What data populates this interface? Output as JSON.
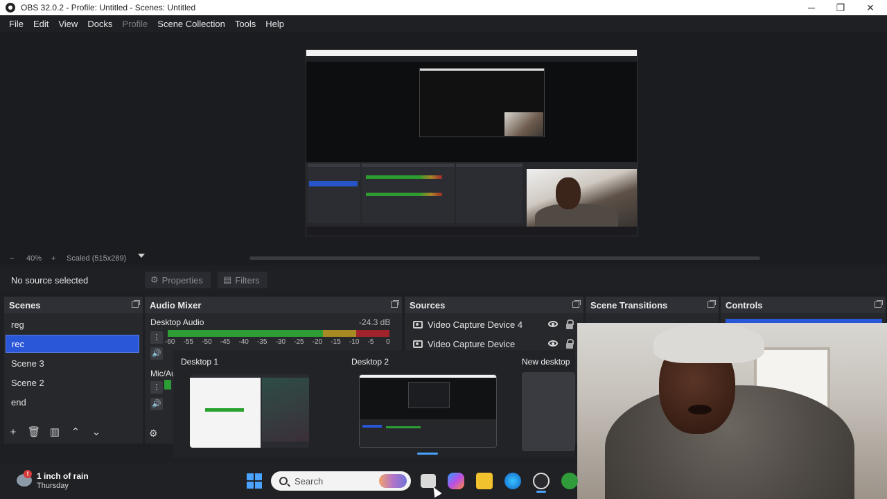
{
  "window": {
    "title": "OBS 32.0.2 - Profile: Untitled - Scenes: Untitled",
    "min_icon": "minimize-icon",
    "max_icon": "restore-icon",
    "close_icon": "close-icon"
  },
  "menu": {
    "items": [
      "File",
      "Edit",
      "View",
      "Docks",
      "Profile",
      "Scene Collection",
      "Tools",
      "Help"
    ]
  },
  "preview_toolbar": {
    "zoom_out": "−",
    "zoom": "40%",
    "zoom_in": "+",
    "scale_mode": "Scaled (515x289)",
    "dropdown_icon": "caret-down-icon"
  },
  "context": {
    "status": "No source selected",
    "properties_label": "Properties",
    "filters_label": "Filters"
  },
  "scenes": {
    "title": "Scenes",
    "items": [
      {
        "label": "reg",
        "active": false
      },
      {
        "label": "rec",
        "active": true
      },
      {
        "label": "Scene 3",
        "active": false
      },
      {
        "label": "Scene 2",
        "active": false
      },
      {
        "label": "end",
        "active": false
      }
    ]
  },
  "mixer": {
    "title": "Audio Mixer",
    "channels": [
      {
        "name": "Desktop Audio",
        "db": "-24.3 dB"
      },
      {
        "name": "Mic/Au",
        "db": ""
      }
    ],
    "ticks": [
      "-60",
      "-55",
      "-50",
      "-45",
      "-40",
      "-35",
      "-30",
      "-25",
      "-20",
      "-15",
      "-10",
      "-5",
      "0"
    ]
  },
  "sources": {
    "title": "Sources",
    "items": [
      "Video Capture Device 4",
      "Video Capture Device"
    ]
  },
  "transitions": {
    "title": "Scene Transitions"
  },
  "controls": {
    "title": "Controls"
  },
  "taskview": {
    "desktops": [
      "Desktop 1",
      "Desktop 2",
      "New desktop"
    ]
  },
  "taskbar": {
    "weather_line1": "1 inch of rain",
    "weather_line2": "Thursday",
    "weather_badge": "!",
    "search_placeholder": "Search"
  },
  "colors": {
    "accent": "#2a56d8",
    "meter_green": "#2c9e35",
    "meter_yellow": "#a78a23",
    "meter_red": "#a1242c"
  }
}
